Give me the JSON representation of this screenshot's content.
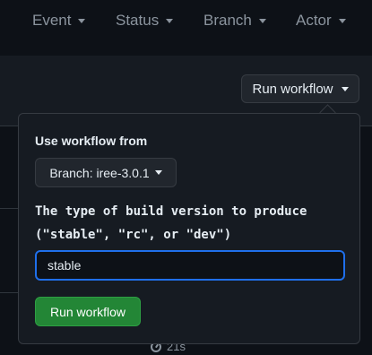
{
  "filters": [
    {
      "label": "Event"
    },
    {
      "label": "Status"
    },
    {
      "label": "Branch"
    },
    {
      "label": "Actor"
    }
  ],
  "run_workflow_button": {
    "label": "Run workflow"
  },
  "background_row": {
    "duration": "21s"
  },
  "popover": {
    "title": "Use workflow from",
    "branch_button": "Branch: iree-3.0.1",
    "input_label": "The type of build version to produce (\"stable\", \"rc\", or \"dev\")",
    "input_value": "stable",
    "submit_label": "Run workflow"
  },
  "colors": {
    "background": "#0d1117",
    "panel": "#161b22",
    "border": "#363b42",
    "focus": "#1f6feb",
    "primary_button": "#238636"
  }
}
